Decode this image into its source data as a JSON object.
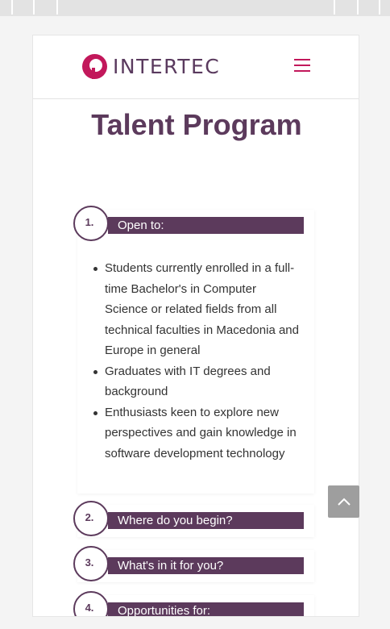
{
  "header": {
    "logo_text": "INTERTEC",
    "menu_icon": "hamburger-icon"
  },
  "page": {
    "title": "Talent Program"
  },
  "sections": [
    {
      "number": "1.",
      "label": "Open to:",
      "items": [
        "Students currently enrolled in a full-time Bachelor's in Computer Science or related fields from all technical faculties in Macedonia and Europe in general",
        "Graduates with IT degrees and background",
        "Enthusiasts keen to explore new perspectives and gain knowledge in software development technology"
      ]
    },
    {
      "number": "2.",
      "label": "Where do you begin?"
    },
    {
      "number": "3.",
      "label": "What's in it for you?"
    },
    {
      "number": "4.",
      "label": "Opportunities for:"
    }
  ],
  "colors": {
    "brand": "#5c3a5c",
    "accent": "#c2185b"
  },
  "scroll_top_icon": "chevron-up-icon"
}
